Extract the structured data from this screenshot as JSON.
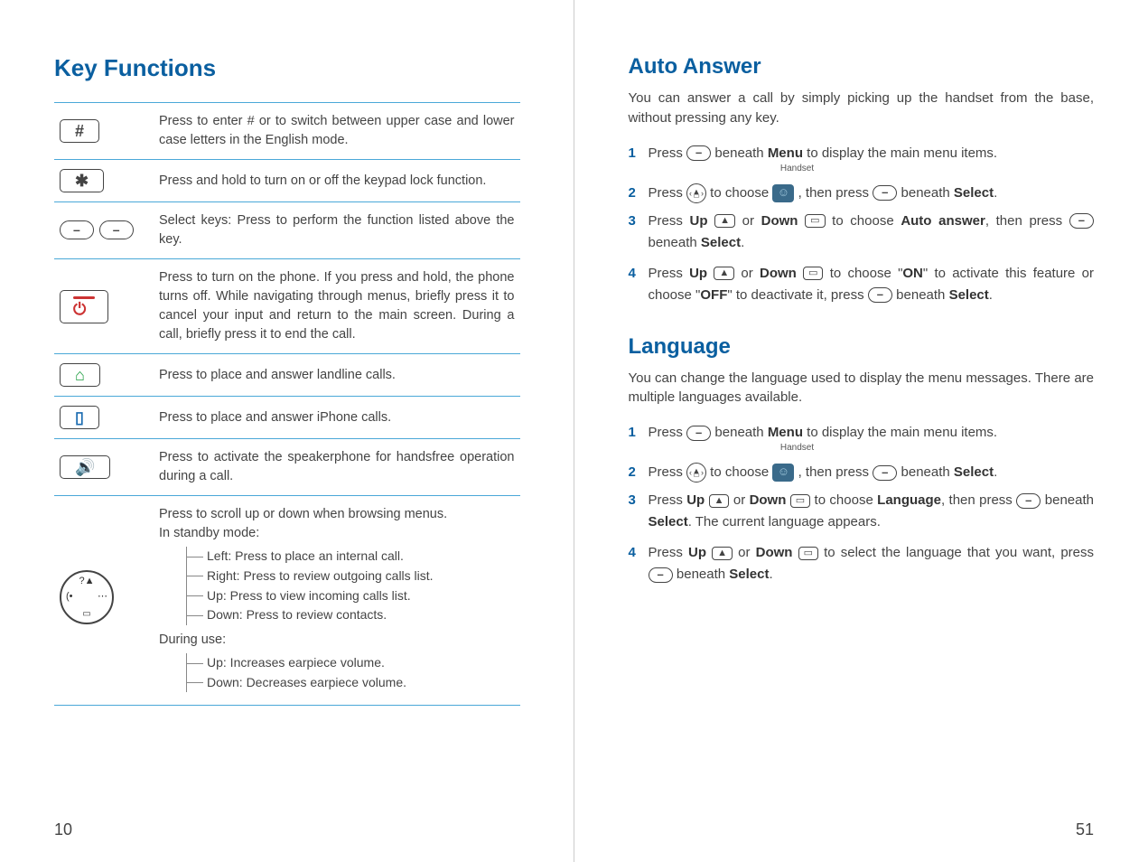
{
  "left": {
    "title": "Key Functions",
    "rows": [
      {
        "icon": "hash",
        "desc": "Press to enter # or to switch between upper case and lower case letters in the English mode."
      },
      {
        "icon": "star",
        "desc": "Press and hold to turn on or off the keypad lock function."
      },
      {
        "icon": "softkeys",
        "desc": "Select keys: Press to perform the function listed above the key."
      },
      {
        "icon": "power",
        "desc": "Press to turn on the phone. If you press and hold, the phone turns off. While navigating through menus, briefly press it to cancel your input and return to the main screen. During a call, briefly press it to end the call."
      },
      {
        "icon": "landline",
        "desc": "Press to place and answer landline calls."
      },
      {
        "icon": "iphone",
        "desc": "Press to place and answer iPhone calls."
      },
      {
        "icon": "speaker",
        "desc": "Press to activate the speakerphone for handsfree operation during a call."
      }
    ],
    "nav_intro1": "Press to scroll up or down when browsing menus.",
    "nav_intro2": "In standby mode:",
    "nav_tree": {
      "left": "Left: Press to place an internal call.",
      "right": "Right: Press to review outgoing calls list.",
      "up": "Up: Press to view incoming calls list.",
      "down": "Down: Press to review contacts."
    },
    "use_intro": "During use:",
    "use_tree": {
      "up": "Up: Increases earpiece volume.",
      "down": "Down: Decreases earpiece volume."
    },
    "page": "10"
  },
  "right": {
    "auto_title": "Auto Answer",
    "auto_intro": "You can answer a call by simply picking up the handset from the base, without pressing any key.",
    "auto_steps": {
      "s1_a": "Press ",
      "s1_b": " beneath ",
      "s1_menu": "Menu",
      "s1_c": " to display the main menu items.",
      "handset_label": "Handset",
      "s2_a": "Press ",
      "s2_b": " to choose ",
      "s2_c": " , then press ",
      "s2_d": " beneath ",
      "s2_sel": "Select",
      "s2_e": ".",
      "s3_a": "Press ",
      "s3_up": "Up",
      "s3_b": " or ",
      "s3_down": "Down",
      "s3_c": " to choose ",
      "s3_item": "Auto answer",
      "s3_d": ", then press ",
      "s3_e": " beneath ",
      "s3_sel": "Select",
      "s3_f": ".",
      "s4_a": "Press ",
      "s4_up": "Up",
      "s4_b": " or ",
      "s4_down": "Down",
      "s4_c": " to choose \"",
      "s4_on": "ON",
      "s4_d": "\" to activate this feature or choose \"",
      "s4_off": "OFF",
      "s4_e": "\" to deactivate it, press ",
      "s4_f": " beneath ",
      "s4_sel": "Select",
      "s4_g": "."
    },
    "lang_title": "Language",
    "lang_intro": "You can change the language used to display the menu messages. There are multiple languages available.",
    "lang_steps": {
      "s1_a": "Press ",
      "s1_b": " beneath ",
      "s1_menu": "Menu",
      "s1_c": " to display the main menu items.",
      "handset_label": "Handset",
      "s2_a": "Press ",
      "s2_b": " to choose ",
      "s2_c": " , then press ",
      "s2_d": " beneath ",
      "s2_sel": "Select",
      "s2_e": ".",
      "s3_a": "Press ",
      "s3_up": "Up",
      "s3_b": " or ",
      "s3_down": "Down",
      "s3_c": " to choose ",
      "s3_item": "Language",
      "s3_d": ", then press ",
      "s3_e": " beneath ",
      "s3_sel": "Select",
      "s3_f": ". The current language appears.",
      "s4_a": "Press ",
      "s4_up": "Up",
      "s4_b": " or ",
      "s4_down": "Down",
      "s4_c": " to select the language that you want, press ",
      "s4_d": " beneath ",
      "s4_sel": "Select",
      "s4_e": "."
    },
    "page": "51"
  }
}
